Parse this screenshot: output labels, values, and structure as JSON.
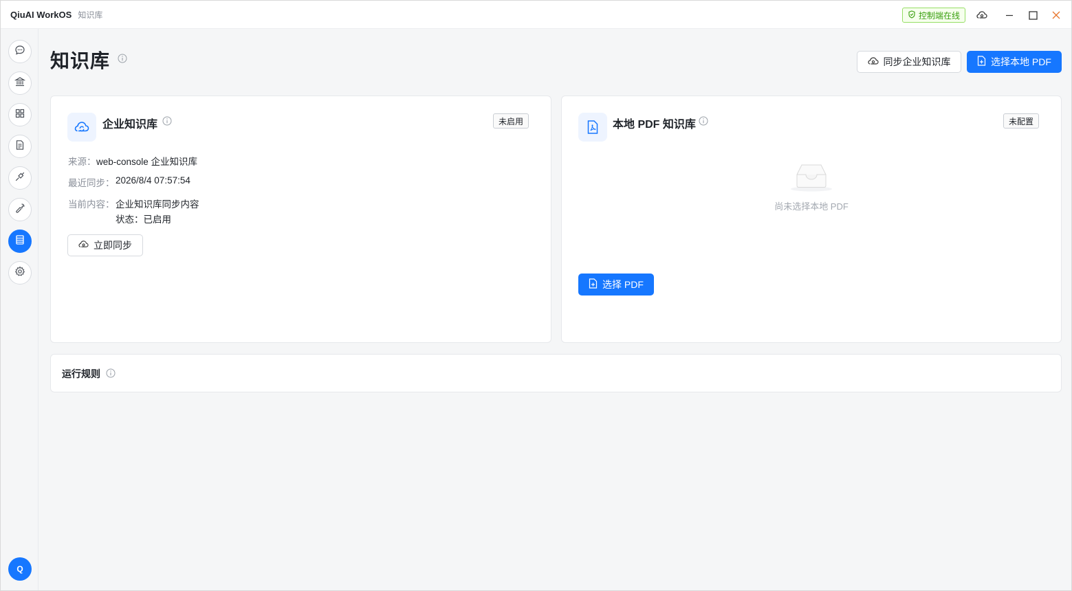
{
  "titlebar": {
    "app_name": "QiuAI WorkOS",
    "subtitle": "知识库",
    "status_label": "控制端在线",
    "status_color": "#389e0d"
  },
  "sidebar": {
    "items": [
      {
        "name": "chat",
        "icon": "chat-bubble-icon"
      },
      {
        "name": "bank",
        "icon": "bank-icon"
      },
      {
        "name": "apps",
        "icon": "grid-icon"
      },
      {
        "name": "documents",
        "icon": "document-icon"
      },
      {
        "name": "integrations",
        "icon": "plug-icon"
      },
      {
        "name": "tools",
        "icon": "wrench-icon"
      },
      {
        "name": "knowledge",
        "icon": "knowledge-icon",
        "active": true
      },
      {
        "name": "settings",
        "icon": "gear-icon"
      }
    ],
    "avatar_initial": "Q"
  },
  "header": {
    "title": "知识库",
    "sync_button": "同步企业知识库",
    "select_pdf_button": "选择本地 PDF"
  },
  "enterprise_card": {
    "title": "企业知识库",
    "tag": "未启用",
    "source_label": "来源：",
    "source_value": "web-console 企业知识库",
    "last_sync_label": "最近同步：",
    "last_sync_value": "2026/8/4 07:57:54",
    "content_label": "当前内容：",
    "content_value": "企业知识库同步内容",
    "status_line": "状态：已启用",
    "sync_now_button": "立即同步"
  },
  "pdf_card": {
    "title": "本地 PDF 知识库",
    "tag": "未配置",
    "empty_text": "尚未选择本地 PDF",
    "select_button": "选择 PDF"
  },
  "rules": {
    "title": "运行规则"
  },
  "colors": {
    "primary": "#1677ff",
    "background": "#f5f6f7"
  }
}
